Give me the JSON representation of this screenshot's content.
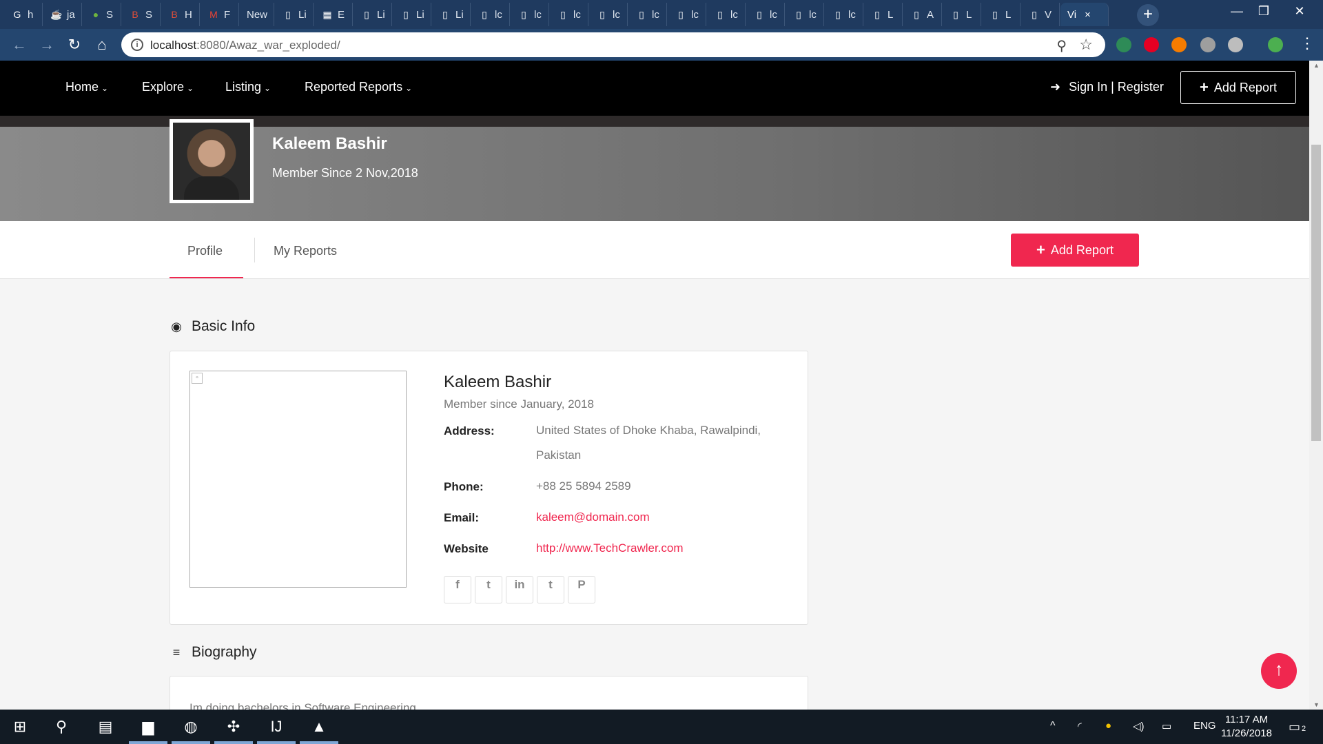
{
  "browser": {
    "tabs": [
      {
        "icon": "G",
        "label": "h",
        "color": "#fff"
      },
      {
        "icon": "☕",
        "label": "ja",
        "color": "#f89820"
      },
      {
        "icon": "●",
        "label": "S",
        "color": "#6db33f"
      },
      {
        "icon": "B",
        "label": "S",
        "color": "#e04e39"
      },
      {
        "icon": "B",
        "label": "H",
        "color": "#e04e39"
      },
      {
        "icon": "M",
        "label": "F",
        "color": "#ea4335"
      },
      {
        "icon": "",
        "label": "New",
        "color": "#fff"
      },
      {
        "icon": "▯",
        "label": "Li",
        "color": "#fff"
      },
      {
        "icon": "▦",
        "label": "E",
        "color": "#fff"
      },
      {
        "icon": "▯",
        "label": "Li",
        "color": "#fff"
      },
      {
        "icon": "▯",
        "label": "Li",
        "color": "#fff"
      },
      {
        "icon": "▯",
        "label": "Li",
        "color": "#fff"
      },
      {
        "icon": "▯",
        "label": "lc",
        "color": "#fff"
      },
      {
        "icon": "▯",
        "label": "lc",
        "color": "#fff"
      },
      {
        "icon": "▯",
        "label": "lc",
        "color": "#fff"
      },
      {
        "icon": "▯",
        "label": "lc",
        "color": "#fff"
      },
      {
        "icon": "▯",
        "label": "lc",
        "color": "#fff"
      },
      {
        "icon": "▯",
        "label": "lc",
        "color": "#fff"
      },
      {
        "icon": "▯",
        "label": "lc",
        "color": "#fff"
      },
      {
        "icon": "▯",
        "label": "lc",
        "color": "#fff"
      },
      {
        "icon": "▯",
        "label": "lc",
        "color": "#fff"
      },
      {
        "icon": "▯",
        "label": "lc",
        "color": "#fff"
      },
      {
        "icon": "▯",
        "label": "L",
        "color": "#fff"
      },
      {
        "icon": "▯",
        "label": "A",
        "color": "#fff"
      },
      {
        "icon": "▯",
        "label": "L",
        "color": "#fff"
      },
      {
        "icon": "▯",
        "label": "L",
        "color": "#fff"
      },
      {
        "icon": "▯",
        "label": "V",
        "color": "#fff"
      },
      {
        "icon": "",
        "label": "Vi",
        "color": "#fff",
        "active": true
      }
    ],
    "new_tab_label": "+",
    "close_tab_label": "×",
    "window_controls": [
      "—",
      "❐",
      "✕"
    ],
    "url_host": "localhost",
    "url_rest": ":8080/Awaz_war_exploded/",
    "toolbar_glyphs": {
      "back": "←",
      "forward": "→",
      "reload": "↻",
      "home": "⌂",
      "info": "i",
      "zoom": "⚲",
      "star": "☆",
      "menu": "⋮"
    },
    "extensions": [
      "#2e8b57",
      "#e60023",
      "#f57c00",
      "#9e9e9e",
      "#bdbdbd",
      "#4caf50"
    ]
  },
  "site_nav": {
    "items": [
      "Home",
      "Explore",
      "Listing",
      "Reported Reports"
    ],
    "chevron": "⌄",
    "signin_icon": "➜",
    "signin": "Sign In | Register",
    "add_icon": "+",
    "add_report": "Add Report"
  },
  "profile": {
    "name": "Kaleem Bashir",
    "member_since": "Member Since 2 Nov,2018"
  },
  "profile_tabs": {
    "items": [
      "Profile",
      "My Reports"
    ],
    "active": "Profile",
    "add_icon": "+",
    "add_report": "Add Report"
  },
  "basic_info": {
    "heading": "Basic Info",
    "icon": "◉",
    "name": "Kaleem Bashir",
    "member_since": "Member since January, 2018",
    "fields": [
      {
        "label": "Address:",
        "value": "United States of Dhoke Khaba, Rawalpindi, Pakistan",
        "link": false
      },
      {
        "label": "Phone:",
        "value": "+88 25 5894 2589",
        "link": false
      },
      {
        "label": "Email:",
        "value": "kaleem@domain.com",
        "link": true
      },
      {
        "label": "Website",
        "value": "http://www.TechCrawler.com",
        "link": true
      }
    ],
    "social": [
      {
        "name": "facebook-icon",
        "glyph": "f"
      },
      {
        "name": "twitter-icon",
        "glyph": "t"
      },
      {
        "name": "linkedin-icon",
        "glyph": "in"
      },
      {
        "name": "tumblr-icon",
        "glyph": "t"
      },
      {
        "name": "pinterest-icon",
        "glyph": "P"
      }
    ]
  },
  "biography": {
    "heading": "Biography",
    "icon": "≡",
    "text": "Im doing bachelors in Software Engineering"
  },
  "scroll_top_icon": "↑",
  "taskbar": {
    "icons": [
      {
        "name": "start-icon",
        "glyph": "⊞"
      },
      {
        "name": "search-icon",
        "glyph": "⚲"
      },
      {
        "name": "task-view-icon",
        "glyph": "▤"
      },
      {
        "name": "file-explorer-icon",
        "glyph": "▆"
      },
      {
        "name": "chrome-icon",
        "glyph": "◍"
      },
      {
        "name": "app-icon",
        "glyph": "✣"
      },
      {
        "name": "intellij-icon",
        "glyph": "IJ"
      },
      {
        "name": "photos-icon",
        "glyph": "▲"
      }
    ],
    "tray_lang": "ENG",
    "tray_up": "^",
    "time": "11:17 AM",
    "date": "11/26/2018",
    "notifications_count": "2"
  },
  "colors": {
    "accent": "#f0274f",
    "nav_bg": "#000000",
    "browser_bg": "#1f3a5f"
  }
}
